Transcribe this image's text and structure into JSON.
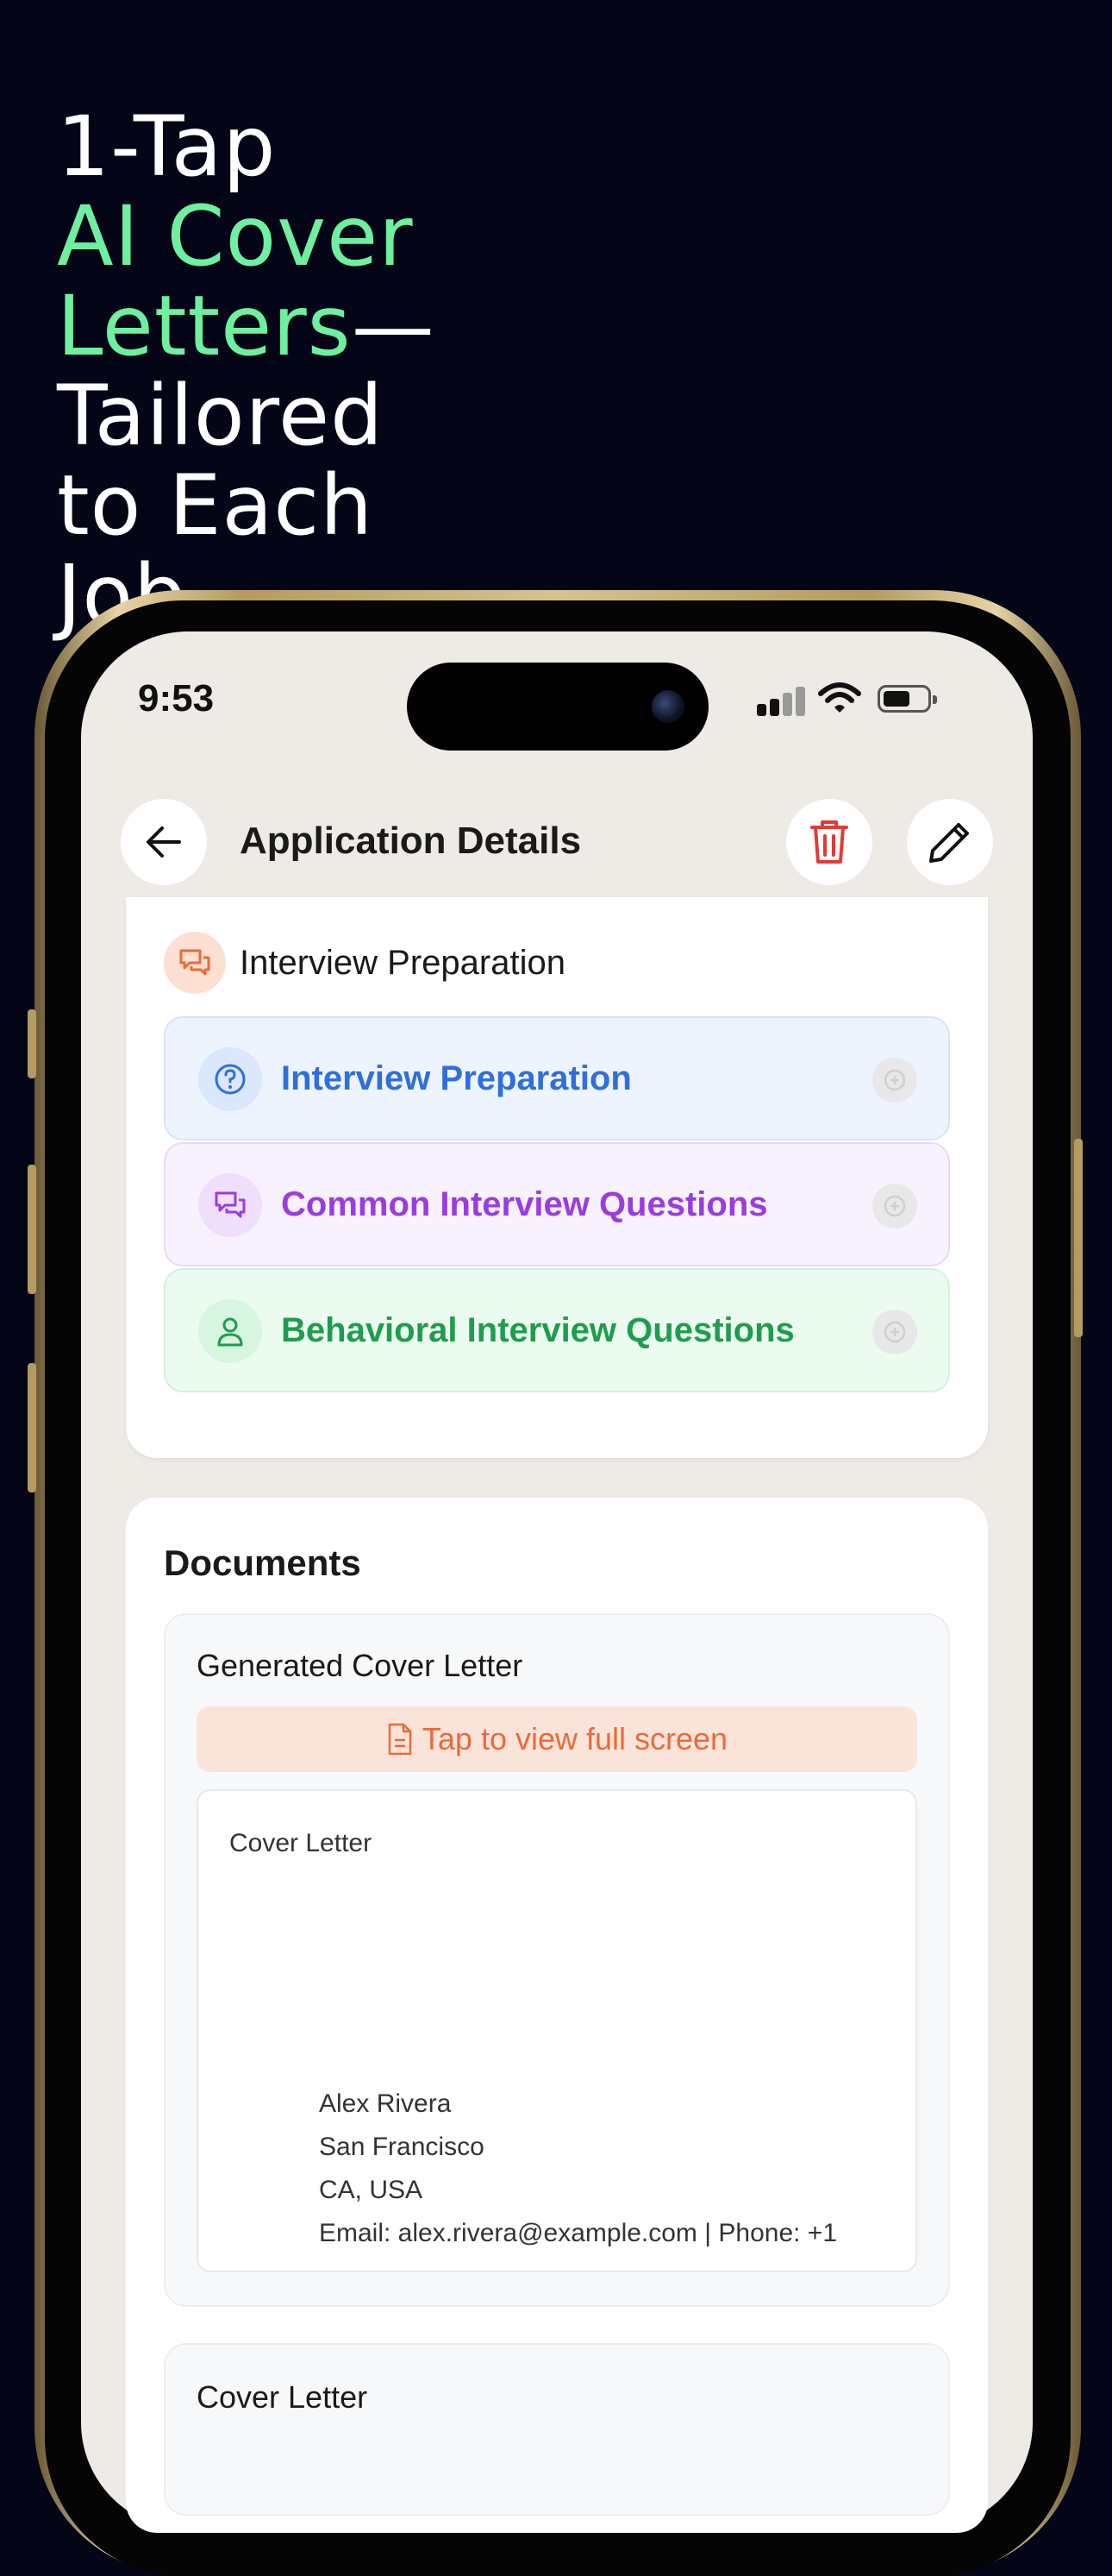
{
  "headline": {
    "line1": "1-Tap",
    "highlight": "AI Cover Letters",
    "rest": "—Tailored to Each Job"
  },
  "status_bar": {
    "time": "9:53"
  },
  "nav": {
    "title": "Application Details"
  },
  "interview_section": {
    "header": "Interview Preparation",
    "items": [
      {
        "label": "Interview Preparation",
        "color": "#2f6fdc",
        "bg": "#eef4fe",
        "border": "#d6e4fb",
        "icon_bg": "#dbe7fc",
        "icon": "help-circle-icon"
      },
      {
        "label": "Common Interview Questions",
        "color": "#9a3ce0",
        "bg": "#f8f1fe",
        "border": "#ead8fb",
        "icon_bg": "#efdffc",
        "icon": "chat-bubbles-icon"
      },
      {
        "label": "Behavioral Interview Questions",
        "color": "#1f9d4e",
        "bg": "#ebfbf0",
        "border": "#d2f1dc",
        "icon_bg": "#d7f5e1",
        "icon": "person-icon"
      }
    ]
  },
  "documents": {
    "header": "Documents",
    "generated": {
      "title": "Generated Cover Letter",
      "view_button": "Tap to view full screen",
      "preview": {
        "title": "Cover Letter",
        "lines": [
          "Alex Rivera",
          "San Francisco",
          "CA, USA",
          "Email: alex.rivera@example.com | Phone: +1"
        ]
      }
    },
    "second": {
      "title": "Cover Letter"
    }
  },
  "colors": {
    "background": "#050518",
    "accent_green": "#6ef0a0",
    "delete_red": "#e53935",
    "orange": "#ec6a38"
  }
}
